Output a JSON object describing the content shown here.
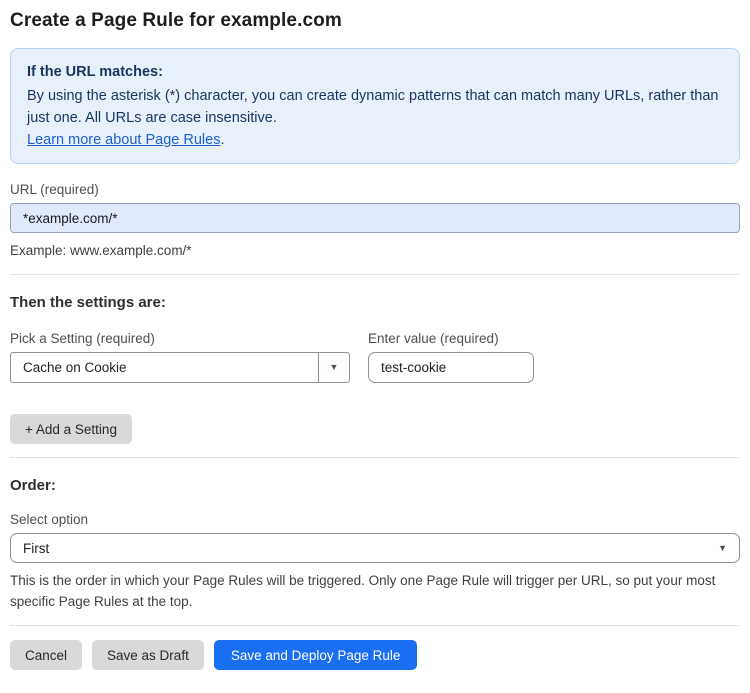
{
  "page": {
    "title": "Create a Page Rule for example.com"
  },
  "info_box": {
    "heading": "If the URL matches:",
    "body": "By using the asterisk (*) character, you can create dynamic patterns that can match many URLs, rather than just one. All URLs are case insensitive.",
    "link_label": "Learn more about Page Rules",
    "link_suffix": "."
  },
  "url_field": {
    "label": "URL (required)",
    "value": "*example.com/*",
    "helper": "Example: www.example.com/*"
  },
  "settings_section": {
    "heading": "Then the settings are:",
    "setting_label": "Pick a Setting (required)",
    "setting_selected": "Cache on Cookie",
    "value_label": "Enter value (required)",
    "value_text": "test-cookie",
    "add_button_label": "+ Add a Setting"
  },
  "order_section": {
    "heading": "Order:",
    "select_label": "Select option",
    "selected_option": "First",
    "helper": "This is the order in which your Page Rules will be triggered. Only one Page Rule will trigger per URL, so put your most specific Page Rules at the top."
  },
  "footer": {
    "cancel_label": "Cancel",
    "save_draft_label": "Save as Draft",
    "save_deploy_label": "Save and Deploy Page Rule"
  },
  "icons": {
    "caret_down": "▼"
  },
  "colors": {
    "accent_blue": "#1a6ef2",
    "info_bg": "#e8f1fb",
    "info_border": "#b7d3ee",
    "info_text": "#17355e",
    "link_blue": "#1d5fcc",
    "url_input_bg": "#dfeafc",
    "button_gray": "#d9d9da"
  }
}
